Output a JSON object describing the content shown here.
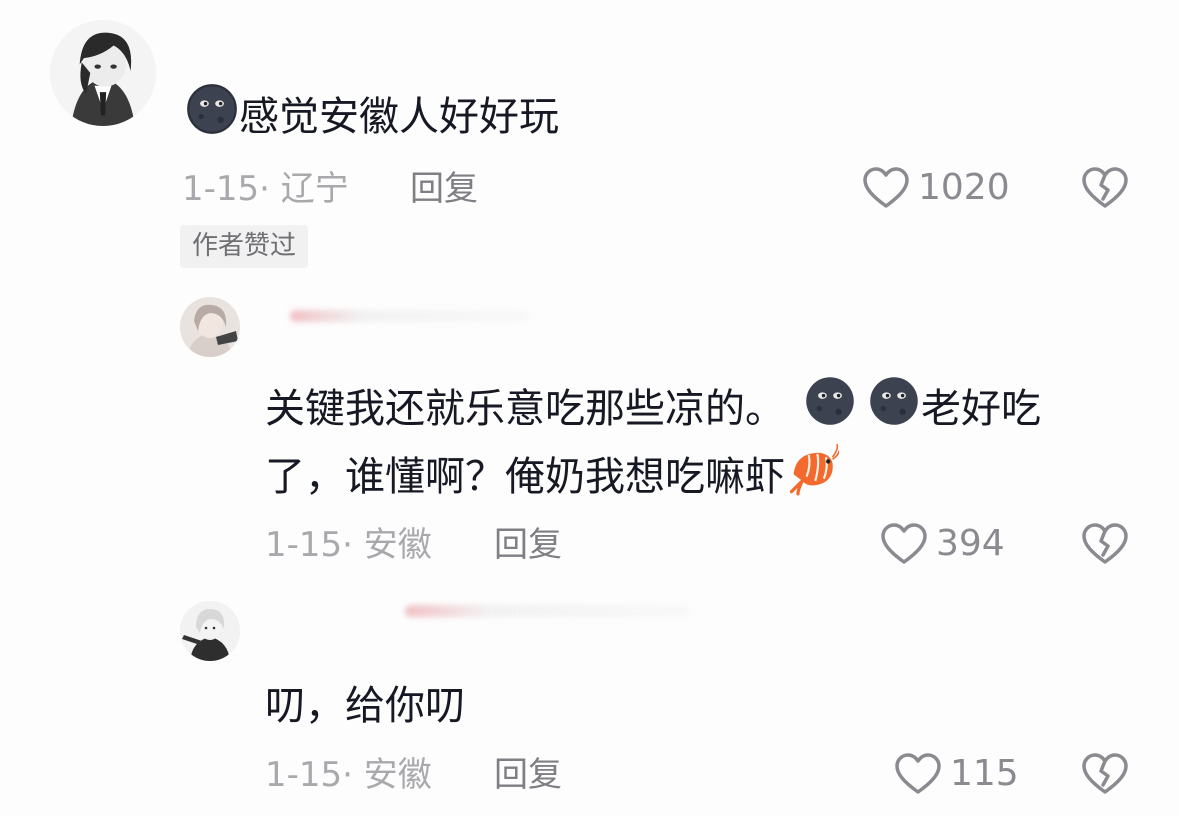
{
  "comments": [
    {
      "text": "感觉安徽人好好玩",
      "date_loc": "1-15· 辽宁",
      "reply_label": "回复",
      "likes": "1020",
      "badge": "作者赞过",
      "avatar_icon": "anime-girl-avatar",
      "emojis": [
        "dark-moon-face-emoji"
      ]
    },
    {
      "text_line1": "关键我还就乐意吃那些凉的。",
      "text_line1_end": "老好吃",
      "text_line2": "了，谁懂啊？俺奶我想吃嘛虾",
      "date_loc": "1-15· 安徽",
      "reply_label": "回复",
      "likes": "394",
      "avatar_icon": "girl-photo-avatar",
      "emojis": [
        "dark-moon-face-emoji",
        "dark-moon-face-emoji",
        "shrimp-emoji"
      ]
    },
    {
      "text": "叨，给你叨",
      "date_loc": "1-15· 安徽",
      "reply_label": "回复",
      "likes": "115",
      "avatar_icon": "anime-character-avatar"
    }
  ],
  "colors": {
    "text": "#161823",
    "meta": "#a9a9ad",
    "reply": "#7e7e84",
    "icon": "#8a8a90"
  }
}
